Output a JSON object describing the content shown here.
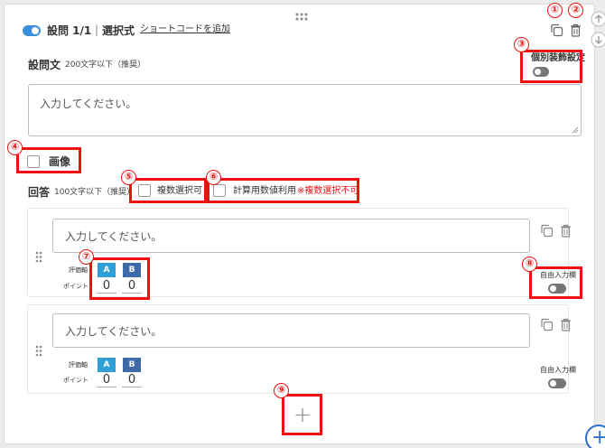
{
  "header": {
    "question_label": "設問 1/1",
    "separator": "|",
    "question_type": "選択式",
    "shortcode_link": "ショートコードを追加"
  },
  "question_text": {
    "label": "設問文",
    "hint": "200文字以下（推奨）",
    "placeholder": "入力してください。"
  },
  "decoration": {
    "label": "個別装飾設定",
    "enabled": false
  },
  "image": {
    "label": "画像"
  },
  "answers_section": {
    "label": "回答",
    "hint": "100文字以下（推奨）",
    "multi_select_label": "複数選択可",
    "calc_label": "計算用数値利用",
    "calc_note": "※複数選択不可"
  },
  "answers": [
    {
      "placeholder": "入力してください。",
      "eval_label": "評価軸",
      "points_label": "ポイント",
      "eval_a": "A",
      "eval_b": "B",
      "points_a": "0",
      "points_b": "0",
      "free_input_label": "自由入力欄",
      "free_input_enabled": false
    },
    {
      "placeholder": "入力してください。",
      "eval_label": "評価軸",
      "points_label": "ポイント",
      "eval_a": "A",
      "eval_b": "B",
      "points_a": "0",
      "points_b": "0",
      "free_input_label": "自由入力欄",
      "free_input_enabled": false
    }
  ],
  "add_answer": {
    "symbol": "+"
  },
  "add_question": {
    "symbol": "+"
  },
  "annotations": [
    "①",
    "②",
    "③",
    "④",
    "⑤",
    "⑥",
    "⑦",
    "⑧",
    "⑨"
  ],
  "colors": {
    "accent_blue": "#3a8fd9",
    "annotation_red": "#e11111",
    "eval_a": "#2f9fd6",
    "eval_b": "#3d6aa8"
  },
  "icons": [
    "drag-handle-icon",
    "copy-icon",
    "trash-icon",
    "arrow-up-icon",
    "arrow-down-icon",
    "plus-icon"
  ]
}
